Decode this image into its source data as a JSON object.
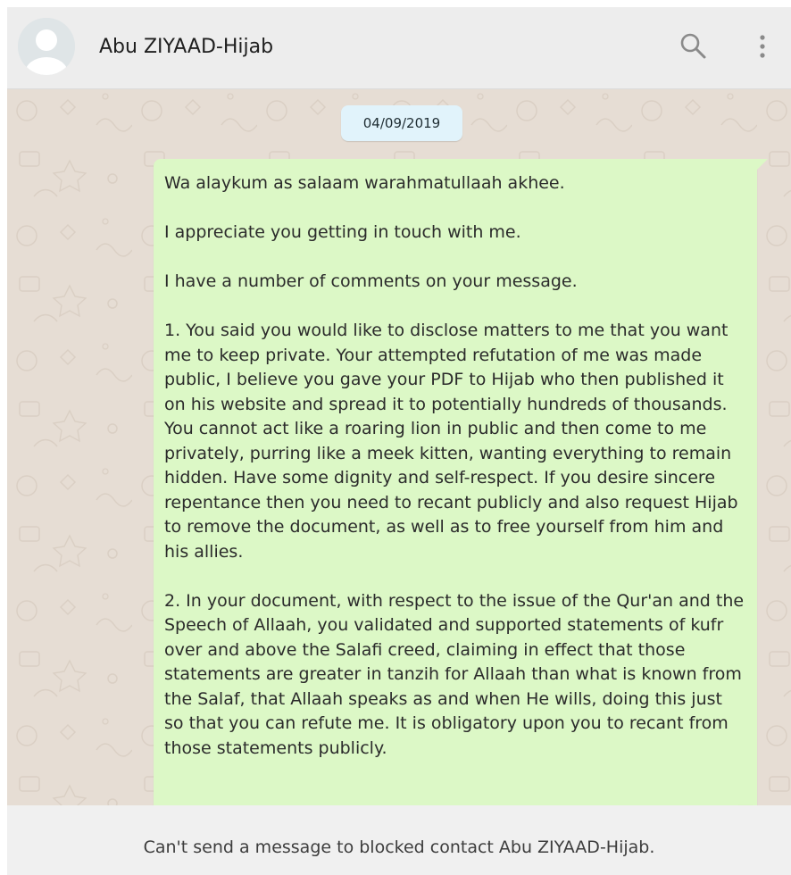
{
  "header": {
    "contact_name": "Abu ZIYAAD-Hijab",
    "icons": {
      "avatar": "default-avatar-icon",
      "search": "search-icon",
      "menu": "more-vertical-icon"
    }
  },
  "chat": {
    "date_chip": "04/09/2019",
    "message": {
      "paragraphs": [
        "Wa alaykum as salaam warahmatullaah akhee.",
        "I appreciate you getting in touch with me.",
        "I have a number of comments on your message.",
        "1. You said you would like to disclose matters to me that you want me to keep private. Your attempted refutation of me was made public, I believe you gave your PDF to Hijab who then published it on his website and spread it to potentially hundreds of thousands. You cannot act like a roaring lion in public and then come to me privately, purring like a meek kitten, wanting everything to remain hidden. Have some dignity and self-respect. If you desire sincere repentance then you need to recant publicly and also request Hijab to remove the document, as well as to free yourself from him and his allies.",
        "2. In your document, with respect to the issue of the Qur'an and the Speech of Allaah, you validated and supported statements of kufr over and above the Salafi creed, claiming in effect that those statements are greater in tanzih for Allaah than what is known from the Salaf, that Allaah speaks as and when He wills, doing this just so that you can refute me. It is obligatory upon you to recant from those statements publicly."
      ]
    },
    "scroll_button_icon": "chevron-down-icon"
  },
  "footer": {
    "blocked_notice": "Can't send a message to blocked contact Abu ZIYAAD-Hijab."
  },
  "colors": {
    "header_bg": "#ededed",
    "chat_bg": "#e6ddd4",
    "bubble_bg": "#dcf8c6",
    "date_chip_bg": "#e1f3fb",
    "footer_bg": "#f0f0f0"
  }
}
